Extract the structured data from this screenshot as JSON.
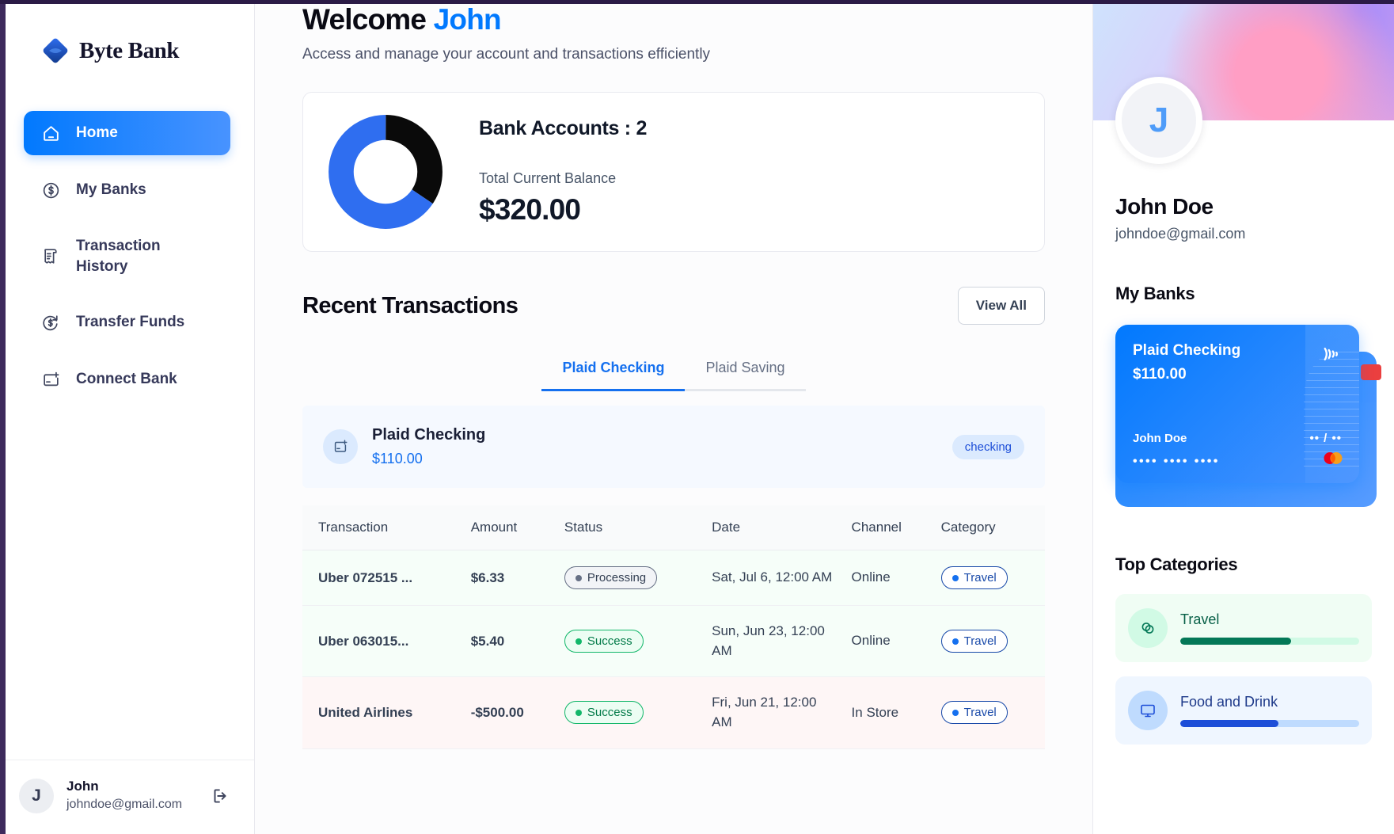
{
  "brand": {
    "name": "Byte Bank",
    "logo_icon": "diamond-logo-icon"
  },
  "sidebar": {
    "items": [
      {
        "label": "Home",
        "icon": "home-icon",
        "active": true
      },
      {
        "label": "My Banks",
        "icon": "dollar-circle-icon",
        "active": false
      },
      {
        "label": "Transaction History",
        "icon": "receipt-icon",
        "active": false
      },
      {
        "label": "Transfer Funds",
        "icon": "dollar-arrow-icon",
        "active": false
      },
      {
        "label": "Connect Bank",
        "icon": "card-plus-icon",
        "active": false
      }
    ],
    "footer": {
      "initial": "J",
      "name": "John",
      "email": "johndoe@gmail.com",
      "logout_icon": "logout-icon"
    }
  },
  "header": {
    "greeting": "Welcome",
    "user_first_name": "John",
    "subtitle": "Access and manage your account and transactions efficiently"
  },
  "balance_card": {
    "accounts_label": "Bank Accounts : 2",
    "total_label": "Total Current Balance",
    "total_amount": "$320.00"
  },
  "chart_data": {
    "type": "pie",
    "title": "Total Current Balance",
    "categories": [
      "Plaid Checking",
      "Plaid Saving"
    ],
    "values": [
      110,
      210
    ],
    "colors": [
      "#0a0a0a",
      "#2f6ef0"
    ],
    "donut": true,
    "legend": "none",
    "total": 320,
    "unit": "USD"
  },
  "transactions_section": {
    "title": "Recent Transactions",
    "view_all_label": "View All",
    "tabs": [
      {
        "label": "Plaid Checking",
        "active": true
      },
      {
        "label": "Plaid Saving",
        "active": false
      }
    ],
    "account_bar": {
      "icon": "card-plus-icon",
      "name": "Plaid Checking",
      "balance": "$110.00",
      "type_badge": "checking"
    },
    "columns": [
      "Transaction",
      "Amount",
      "Status",
      "Date",
      "Channel",
      "Category"
    ],
    "rows": [
      {
        "name": "Uber 072515 ...",
        "amount": "$6.33",
        "amount_sign": "positive",
        "status": "Processing",
        "status_type": "processing",
        "date": "Sat, Jul 6, 12:00 AM",
        "channel": "Online",
        "category": "Travel",
        "row_type": "credit"
      },
      {
        "name": "Uber 063015...",
        "amount": "$5.40",
        "amount_sign": "positive",
        "status": "Success",
        "status_type": "success",
        "date": "Sun, Jun 23, 12:00 AM",
        "channel": "Online",
        "category": "Travel",
        "row_type": "credit"
      },
      {
        "name": "United Airlines",
        "amount": "-$500.00",
        "amount_sign": "negative",
        "status": "Success",
        "status_type": "success",
        "date": "Fri, Jun 21, 12:00 AM",
        "channel": "In Store",
        "category": "Travel",
        "row_type": "debit"
      }
    ]
  },
  "right_panel": {
    "profile": {
      "initial": "J",
      "name": "John Doe",
      "email": "johndoe@gmail.com"
    },
    "my_banks": {
      "title": "My Banks",
      "card": {
        "bank_name": "Plaid Checking",
        "amount": "$110.00",
        "holder": "John Doe",
        "expiry": "•• / ••",
        "number": "•••• •••• ••••",
        "wifi_icon": "contactless-icon",
        "network_icon": "mastercard-icon"
      }
    },
    "top_categories": {
      "title": "Top Categories",
      "items": [
        {
          "name": "Travel",
          "icon": "rings-icon",
          "percent": 62,
          "bg": "#f0fdf4",
          "icon_bg": "#d1fae5",
          "bar_track": "#d1fae5",
          "bar_fill": "#047857",
          "text_color": "#065f46"
        },
        {
          "name": "Food and Drink",
          "icon": "monitor-icon",
          "percent": 55,
          "bg": "#eff6ff",
          "icon_bg": "#bfdbfe",
          "bar_track": "#bfdbfe",
          "bar_fill": "#1d4ed8",
          "text_color": "#1e3a8a"
        }
      ]
    }
  },
  "colors": {
    "brand_blue": "#0179fe",
    "accent_blue": "#1570ef",
    "success_green": "#039855",
    "danger_red": "#f04438",
    "dark_text": "#0a0a14"
  }
}
